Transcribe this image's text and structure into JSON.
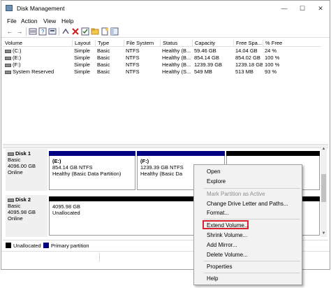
{
  "window": {
    "title": "Disk Management",
    "controls": {
      "minimize": "—",
      "maximize": "☐",
      "close": "✕"
    }
  },
  "menubar": [
    "File",
    "Action",
    "View",
    "Help"
  ],
  "toolbar": {
    "icons": [
      "back-arrow-icon",
      "forward-arrow-icon",
      "volume-list-icon",
      "help-icon",
      "properties-icon",
      "connect-icon",
      "delete-icon",
      "check-icon",
      "folder-icon",
      "new-icon",
      "panel-icon"
    ]
  },
  "volume_table": {
    "columns": [
      "Volume",
      "Layout",
      "Type",
      "File System",
      "Status",
      "Capacity",
      "Free Spa...",
      "% Free"
    ],
    "rows": [
      [
        "(C:)",
        "Simple",
        "Basic",
        "NTFS",
        "Healthy (B...",
        "59.46 GB",
        "14.04 GB",
        "24 %"
      ],
      [
        "(E:)",
        "Simple",
        "Basic",
        "NTFS",
        "Healthy (B...",
        "854.14 GB",
        "854.02 GB",
        "100 %"
      ],
      [
        "(F:)",
        "Simple",
        "Basic",
        "NTFS",
        "Healthy (B...",
        "1239.39 GB",
        "1239.18 GB",
        "100 %"
      ],
      [
        "System Reserved",
        "Simple",
        "Basic",
        "NTFS",
        "Healthy (S...",
        "549 MB",
        "513 MB",
        "93 %"
      ]
    ]
  },
  "disks": [
    {
      "name": "Disk 1",
      "type": "Basic",
      "size": "4096.00 GB",
      "state": "Online",
      "partitions": [
        {
          "title": "(E:)",
          "size": "854.14 GB NTFS",
          "status": "Healthy (Basic Data Partition)"
        },
        {
          "title": "(F:)",
          "size": "1239.39 GB NTFS",
          "status": "Healthy (Basic Da"
        }
      ]
    },
    {
      "name": "Disk 2",
      "type": "Basic",
      "size": "4095.98 GB",
      "state": "Online",
      "partitions": [
        {
          "title": "4095.98 GB",
          "status": "Unallocated"
        }
      ]
    }
  ],
  "legend": {
    "unallocated": {
      "label": "Unallocated",
      "color": "#000000"
    },
    "primary": {
      "label": "Primary partition",
      "color": "#000080"
    }
  },
  "context_menu": {
    "items": [
      {
        "label": "Open",
        "enabled": true
      },
      {
        "label": "Explore",
        "enabled": true
      },
      {
        "label": "Mark Partition as Active",
        "enabled": false
      },
      {
        "label": "Change Drive Letter and Paths...",
        "enabled": true
      },
      {
        "label": "Format...",
        "enabled": true
      },
      {
        "label": "Extend Volume...",
        "enabled": true,
        "highlighted": true
      },
      {
        "label": "Shrink Volume...",
        "enabled": true
      },
      {
        "label": "Add Mirror...",
        "enabled": true
      },
      {
        "label": "Delete Volume...",
        "enabled": true
      },
      {
        "label": "Properties",
        "enabled": true
      },
      {
        "label": "Help",
        "enabled": true
      }
    ],
    "highlight_color": "#d9232f"
  }
}
